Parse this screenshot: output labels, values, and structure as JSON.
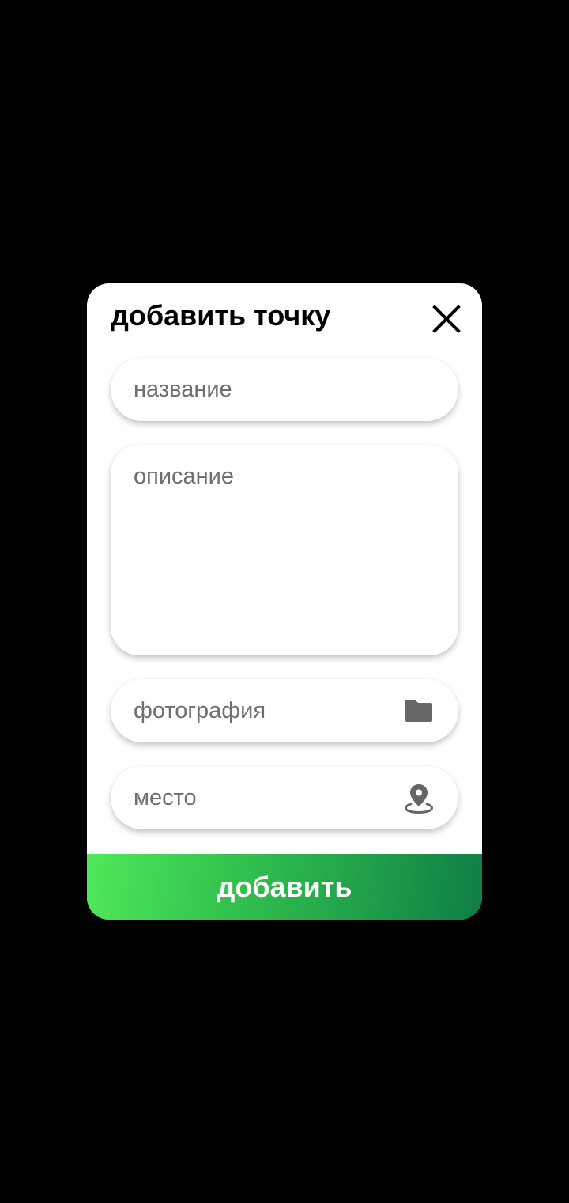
{
  "dialog": {
    "title": "добавить точку",
    "close_icon": "close-icon",
    "fields": {
      "name": {
        "placeholder": "название",
        "value": ""
      },
      "description": {
        "placeholder": "описание",
        "value": ""
      },
      "photo": {
        "placeholder": "фотография",
        "value": "",
        "icon": "folder-icon"
      },
      "place": {
        "placeholder": "место",
        "value": "",
        "icon": "location-pin-icon"
      }
    },
    "submit_label": "добавить"
  },
  "colors": {
    "backdrop": "#000000",
    "dialog_background": "#ffffff",
    "submit_gradient_start": "#4fe85a",
    "submit_gradient_end": "#0f7d45",
    "submit_text": "#ffffff",
    "placeholder": "#6f6f6f",
    "icon": "#666666"
  }
}
